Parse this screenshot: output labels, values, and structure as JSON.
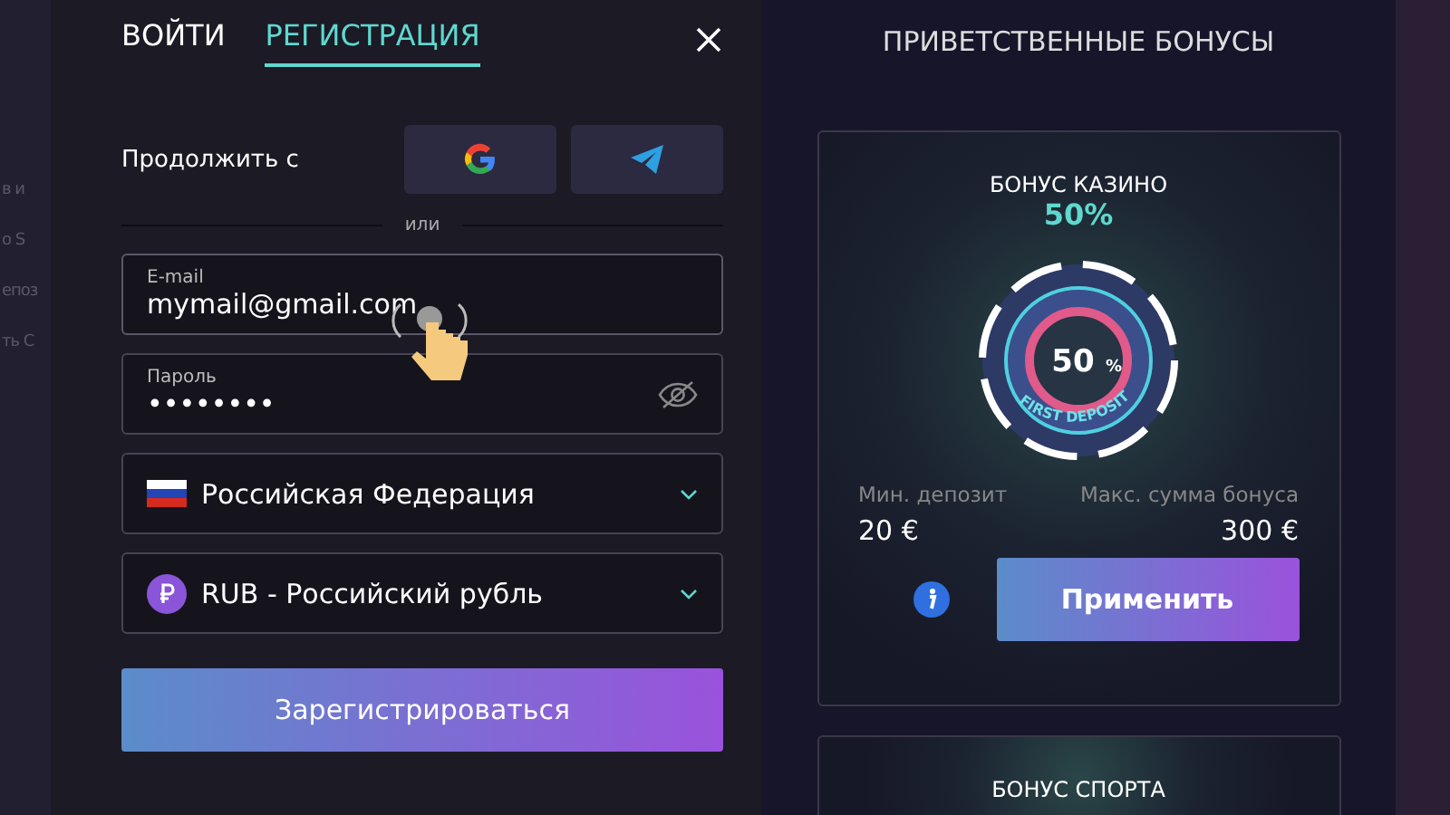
{
  "background_fragments": [
    "в и",
    "о S",
    "епоз",
    "ть С"
  ],
  "auth_tabs": [
    {
      "label": "ВОЙТИ",
      "selected": false
    },
    {
      "label": "РЕГИСТРАЦИЯ",
      "selected": true
    }
  ],
  "continue_with": {
    "label": "Продолжить с",
    "providers": [
      {
        "kind": "google"
      },
      {
        "kind": "telegram"
      }
    ]
  },
  "divider_text": "или",
  "fields": [
    {
      "kind": "text",
      "label": "E-mail",
      "value": "mymail@gmail.com",
      "focused": true
    },
    {
      "kind": "password",
      "label": "Пароль",
      "value": "••••••••"
    }
  ],
  "selects": [
    {
      "kind": "country",
      "value": "Российская Федерация"
    },
    {
      "kind": "currency",
      "value": "RUB - Российский рубль"
    }
  ],
  "register_button": "Зарегистрироваться",
  "bonuses": {
    "title": "ПРИВЕТСТВЕННЫЕ БОНУСЫ",
    "cards": [
      {
        "title": "БОНУС КАЗИНО",
        "percent": "50%",
        "chip": {
          "value": "50",
          "unit": "%",
          "caption": "FIRST DEPOSIT"
        },
        "min_label": "Мин. депозит",
        "min_value": "20 €",
        "max_label": "Макс. сумма бонуса",
        "max_value": "300 €",
        "apply": "Применить"
      },
      {
        "title": "БОНУС СПОРТА"
      }
    ]
  }
}
